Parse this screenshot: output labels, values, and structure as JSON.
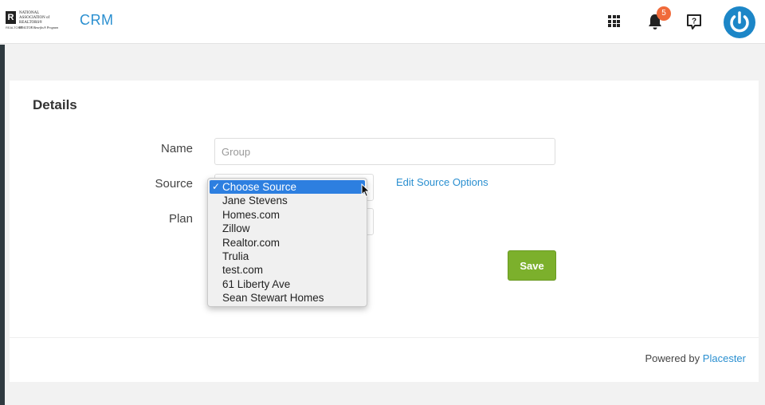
{
  "header": {
    "logo": {
      "mark": "R",
      "realtor_small": "REALTOR®",
      "lines": [
        "NATIONAL",
        "ASSOCIATION of",
        "REALTORS®",
        "REALTOR Benefits® Program"
      ]
    },
    "app_name": "CRM",
    "notification_count": "5",
    "icons": [
      "apps-grid-icon",
      "bell-icon",
      "help-icon",
      "power-icon"
    ],
    "accent_color": "#2a8fd0"
  },
  "form": {
    "section_title": "Details",
    "name_label": "Name",
    "name_placeholder": "Group",
    "source_label": "Source",
    "plan_label": "Plan",
    "edit_source_link": "Edit Source Options",
    "save_label": "Save"
  },
  "source_dropdown": {
    "selected": "Choose Source",
    "options": [
      "Choose Source",
      "Jane Stevens",
      "Homes.com",
      "Zillow",
      "Realtor.com",
      "Trulia",
      "test.com",
      "61 Liberty Ave",
      "Sean Stewart Homes"
    ]
  },
  "footer": {
    "powered_by": "Powered by",
    "brand": "Placester"
  }
}
